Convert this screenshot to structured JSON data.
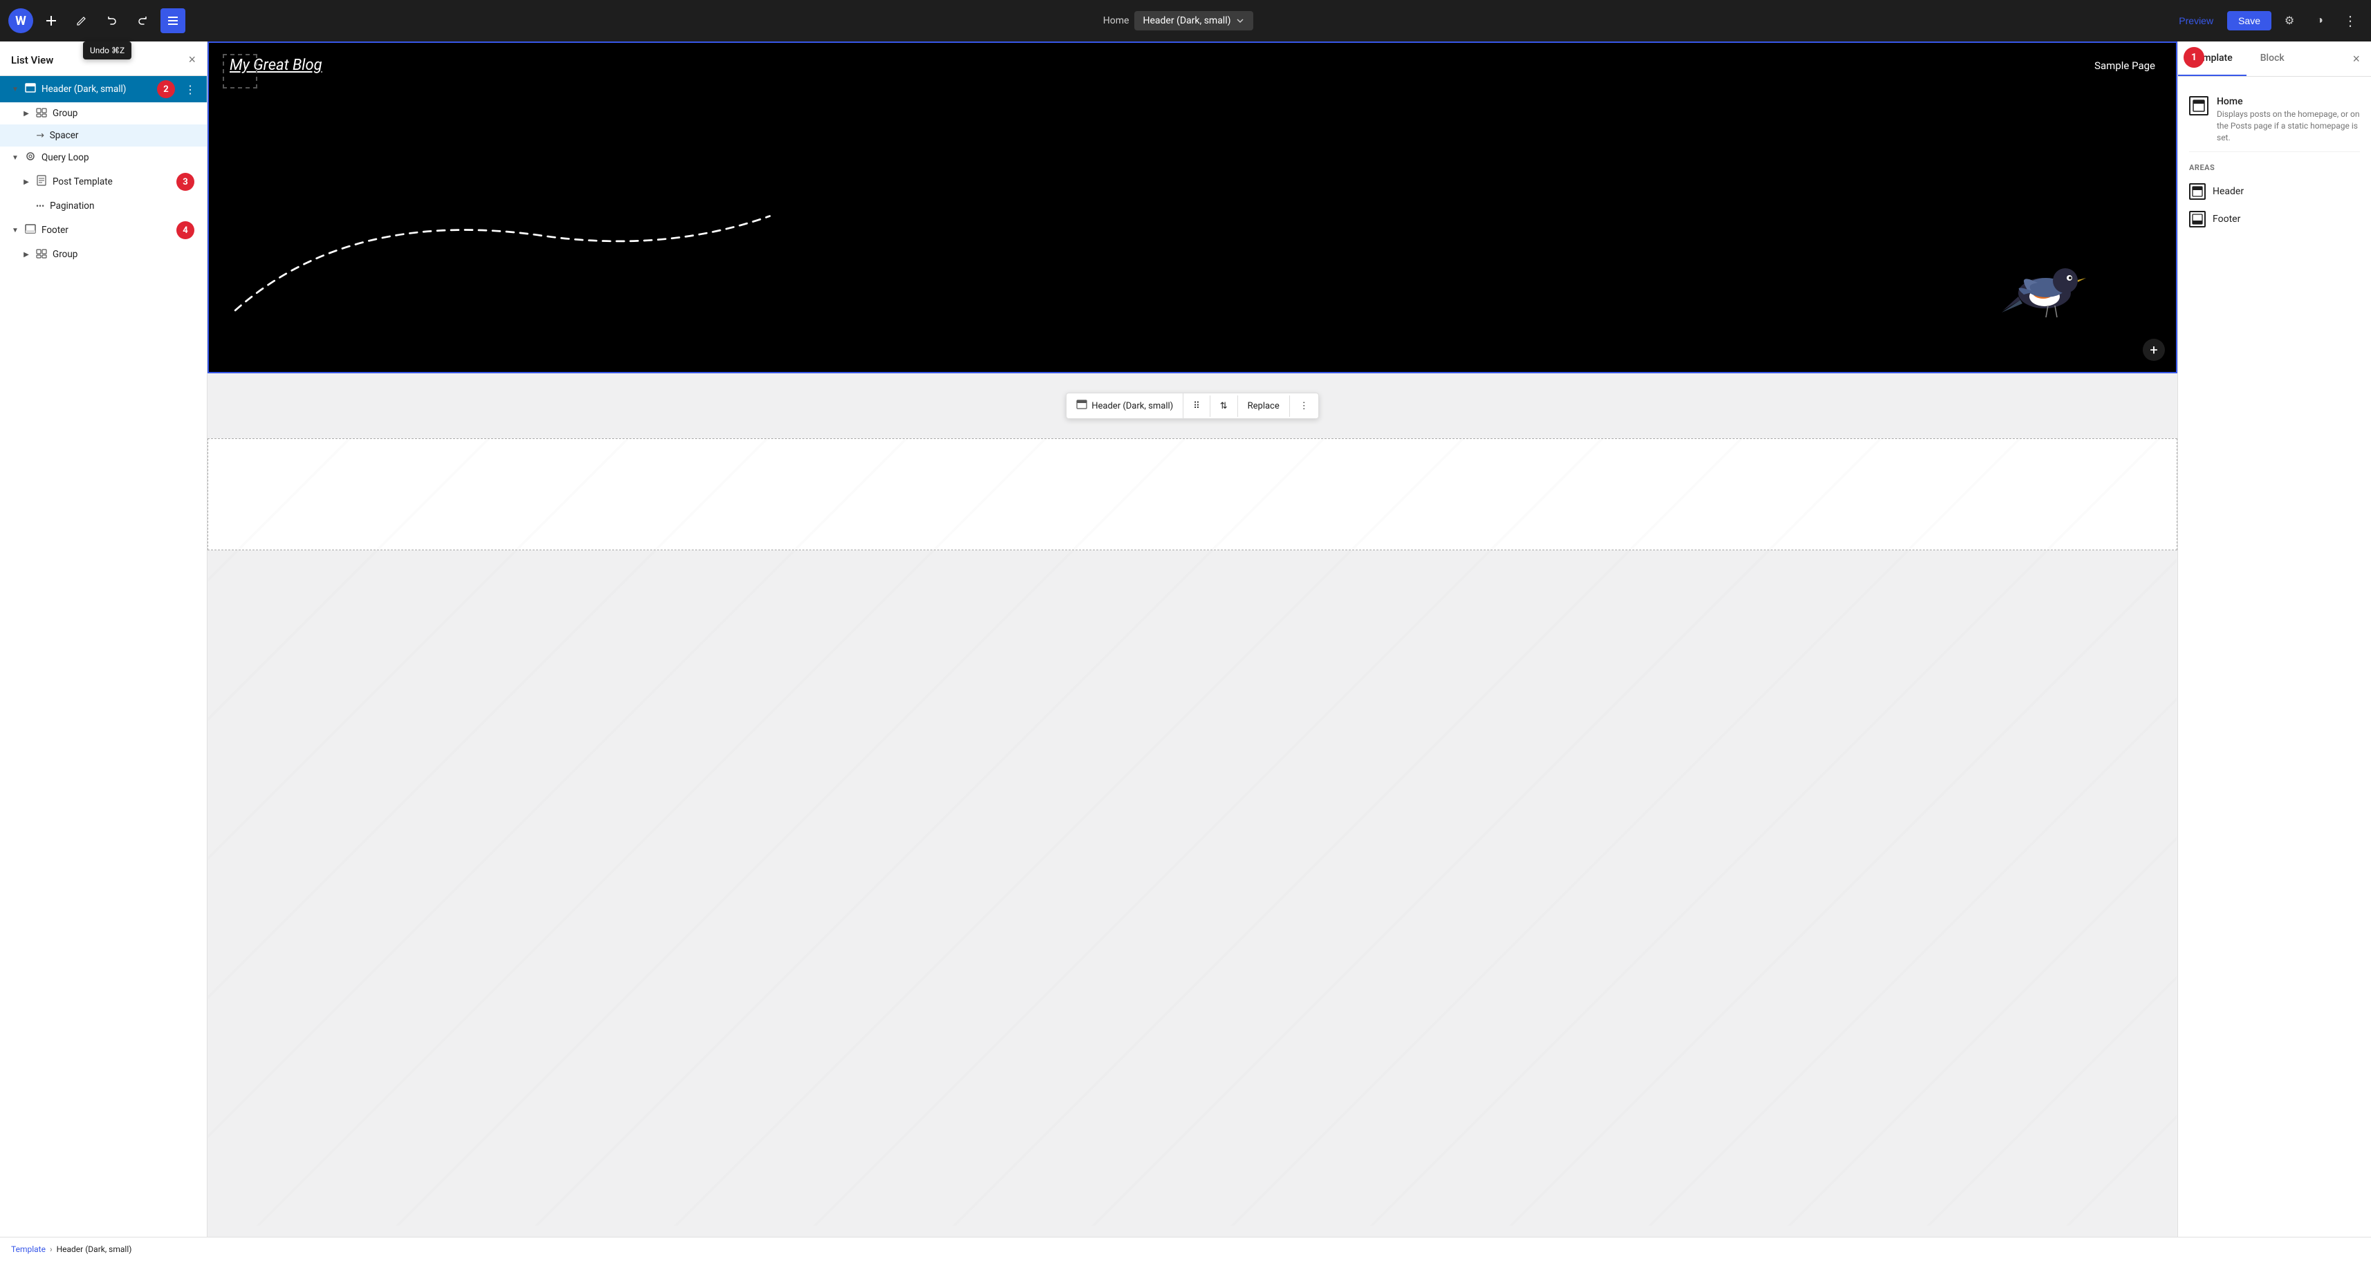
{
  "toolbar": {
    "home_label": "Home",
    "active_block": "Header (Dark, small)",
    "preview_label": "Preview",
    "save_label": "Save",
    "undo_tooltip": "Undo ⌘Z"
  },
  "list_view": {
    "title": "List View",
    "close_label": "×",
    "items": [
      {
        "id": "header",
        "label": "Header (Dark, small)",
        "indent": 0,
        "expanded": true,
        "has_badge": true,
        "badge_num": "2",
        "selected": true
      },
      {
        "id": "group1",
        "label": "Group",
        "indent": 1,
        "expanded": false
      },
      {
        "id": "spacer",
        "label": "Spacer",
        "indent": 1,
        "expanded": false,
        "icon": "↗"
      },
      {
        "id": "query-loop",
        "label": "Query Loop",
        "indent": 0,
        "expanded": true
      },
      {
        "id": "post-template",
        "label": "Post Template",
        "indent": 1,
        "has_badge": true,
        "badge_num": "3"
      },
      {
        "id": "pagination",
        "label": "Pagination",
        "indent": 1
      },
      {
        "id": "footer",
        "label": "Footer",
        "indent": 0,
        "expanded": true,
        "has_badge": true,
        "badge_num": "4"
      },
      {
        "id": "group2",
        "label": "Group",
        "indent": 1
      }
    ]
  },
  "canvas": {
    "blog_title": "My Great Blog",
    "sample_page": "Sample Page",
    "header_block_label": "Header (Dark, small)",
    "replace_label": "Replace"
  },
  "right_sidebar": {
    "tab_template": "Template",
    "tab_block": "Block",
    "badge_num": "1",
    "template_name": "Home",
    "template_desc": "Displays posts on the homepage, or on the Posts page if a static homepage is set.",
    "areas_label": "AREAS",
    "areas": [
      {
        "name": "Header"
      },
      {
        "name": "Footer"
      }
    ]
  },
  "bottom_bar": {
    "template_label": "Template",
    "separator": "›",
    "current_label": "Header (Dark, small)"
  }
}
